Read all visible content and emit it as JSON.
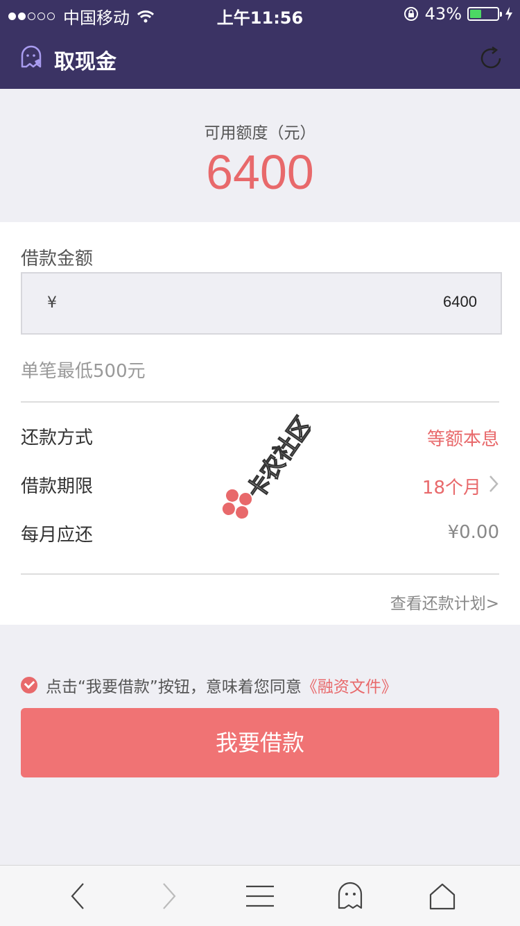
{
  "status_bar": {
    "carrier": "中国移动",
    "time": "上午11:56",
    "battery": "43%"
  },
  "header": {
    "title": "取现金"
  },
  "quota": {
    "label": "可用额度（元）",
    "amount": "6400"
  },
  "loan": {
    "label": "借款金额",
    "currency": "¥",
    "amount_value": "6400",
    "min_note": "单笔最低500元"
  },
  "details": {
    "repay_method_label": "还款方式",
    "repay_method_value": "等额本息",
    "term_label": "借款期限",
    "term_value": "18个月",
    "monthly_label": "每月应还",
    "monthly_value": "¥0.00",
    "plan_link": "查看还款计划>"
  },
  "watermark": {
    "text": "卡农社区"
  },
  "agreement": {
    "text": "点击“我要借款”按钮，意味着您同意",
    "link": "《融资文件》"
  },
  "actions": {
    "borrow_button": "我要借款"
  },
  "colors": {
    "header_bg": "#3b3364",
    "accent": "#e8696b",
    "button": "#f07374"
  }
}
